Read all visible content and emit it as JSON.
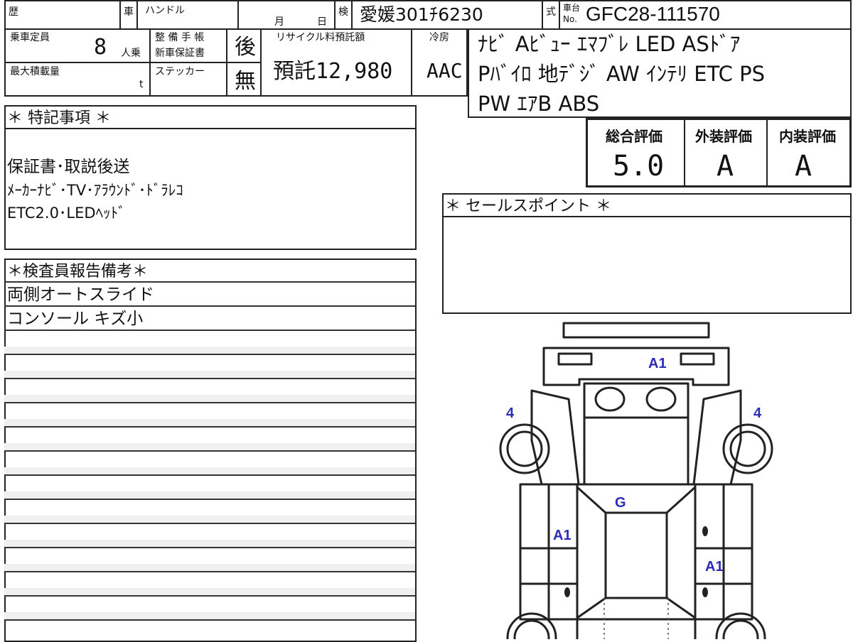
{
  "header": {
    "history_label": "歴",
    "car_label": "車",
    "handle_label": "ハンドル",
    "month_label": "月",
    "day_label": "日",
    "inspection_label": "検",
    "inspection_value": "愛媛301ﾁ6230",
    "type_label": "式",
    "chassis_label_top": "車台",
    "chassis_label_no": "No.",
    "chassis_value": "GFC28-111570"
  },
  "row2": {
    "capacity_label": "乗車定員",
    "capacity_value": "8",
    "capacity_unit": "人乗",
    "maintenance_label": "整 備 手 帳",
    "warranty_label": "新車保証書",
    "maintenance_value": "後",
    "recycle_label": "リサイクル料預託額",
    "recycle_value": "預託12,980",
    "ac_label": "冷房",
    "ac_value": "AAC",
    "max_load_label": "最大積載量",
    "max_load_unit": "t",
    "sticker_label": "ステッカー",
    "sticker_value": "無"
  },
  "equipment": {
    "lines": [
      "ﾅﾋﾞ Aﾋﾞｭｰ ｴﾏﾌﾞﾚ LED ASﾄﾞｱ",
      "Pﾊﾞｲﾛ 地ﾃﾞｼﾞ AW ｲﾝﾃﾘ ETC PS",
      "PW ｴｱB ABS"
    ]
  },
  "scores": {
    "overall_label": "総合評価",
    "exterior_label": "外装評価",
    "interior_label": "内装評価",
    "overall_value": "5.0",
    "exterior_value": "A",
    "interior_value": "A"
  },
  "special": {
    "title": "＊ 特記事項 ＊",
    "lines": [
      "保証書･取説後送",
      "ﾒｰｶｰﾅﾋﾞ･TV･ｱﾗｳﾝﾄﾞ･ﾄﾞﾗﾚｺ",
      "ETC2.0･LEDﾍｯﾄﾞ"
    ]
  },
  "sales_point": {
    "title": "＊ セールスポイント ＊"
  },
  "inspector": {
    "title": "＊検査員報告備考＊",
    "lines": [
      "両側オートスライド",
      "コンソール キズ小"
    ]
  },
  "damage_marks": {
    "front_center": "A1",
    "front_left_wheel": "4",
    "front_right_wheel": "4",
    "roof": "G",
    "left_side": "A1",
    "right_side": "A1"
  },
  "colors": {
    "line": "#222222",
    "damage_mark": "#2b2bb8",
    "watermark": "#e4e4e4"
  }
}
